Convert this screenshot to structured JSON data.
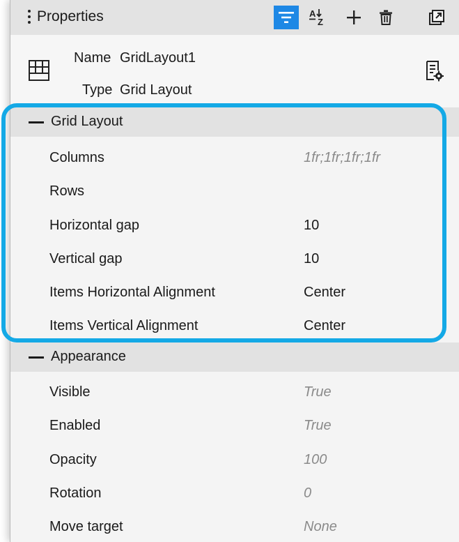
{
  "header": {
    "title": "Properties",
    "toolbar": [
      {
        "name": "categorized-view-button",
        "icon": "list-filter-icon",
        "active": true
      },
      {
        "name": "sort-alphabetical-button",
        "icon": "sort-az-icon",
        "active": false
      },
      {
        "name": "add-button",
        "icon": "plus-icon",
        "active": false
      },
      {
        "name": "delete-button",
        "icon": "trash-icon",
        "active": false
      },
      {
        "name": "popout-button",
        "icon": "popout-icon",
        "active": false
      }
    ]
  },
  "info": {
    "name_label": "Name",
    "name_value": "GridLayout1",
    "type_label": "Type",
    "type_value": "Grid Layout",
    "component_icon": "grid-layout-icon",
    "action_icon": "settings-document-icon"
  },
  "sections": [
    {
      "title": "Grid Layout",
      "properties": [
        {
          "name": "Columns",
          "value": "1fr;1fr;1fr;1fr",
          "default": true
        },
        {
          "name": "Rows",
          "value": "",
          "default": false
        },
        {
          "name": "Horizontal gap",
          "value": "10",
          "default": false
        },
        {
          "name": "Vertical gap",
          "value": "10",
          "default": false
        },
        {
          "name": "Items Horizontal Alignment",
          "value": "Center",
          "default": false
        },
        {
          "name": "Items Vertical Alignment",
          "value": "Center",
          "default": false
        }
      ]
    },
    {
      "title": "Appearance",
      "properties": [
        {
          "name": "Visible",
          "value": "True",
          "default": true
        },
        {
          "name": "Enabled",
          "value": "True",
          "default": true
        },
        {
          "name": "Opacity",
          "value": "100",
          "default": true
        },
        {
          "name": "Rotation",
          "value": "0",
          "default": true
        },
        {
          "name": "Move target",
          "value": "None",
          "default": true
        }
      ]
    }
  ],
  "colors": {
    "accent": "#1e88e5",
    "highlight": "#14a9e6",
    "default_value": "#8a8a8a"
  }
}
